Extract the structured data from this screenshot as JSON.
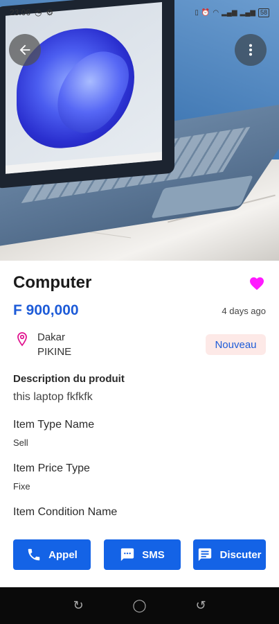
{
  "status_bar": {
    "time": "23:06",
    "left_icons": [
      "clock-icon",
      "notification-icon"
    ],
    "right_icons": [
      "vibrate-icon",
      "alarm-icon",
      "wifi-icon",
      "signal-icon",
      "signal-icon"
    ],
    "battery": "58"
  },
  "header": {
    "back_icon": "arrow-back-icon",
    "more_icon": "more-vertical-icon"
  },
  "product": {
    "title": "Computer",
    "price": "F 900,000",
    "posted": "4 days ago",
    "favorite_color": "#ff1aff",
    "location_city": "Dakar",
    "location_area": "PIKINE",
    "condition_badge": "Nouveau",
    "description_label": "Description du produit",
    "description": "this laptop fkfkfk"
  },
  "attributes": [
    {
      "label": "Item Type Name",
      "value": "Sell"
    },
    {
      "label": "Item Price Type",
      "value": "Fixe"
    },
    {
      "label": "Item Condition Name",
      "value": ""
    }
  ],
  "actions": {
    "call_label": "Appel",
    "sms_label": "SMS",
    "chat_label": "Discuter",
    "accent_color": "#1463e6"
  },
  "nav_bar": {
    "recent_icon": "recent-apps-icon",
    "home_icon": "home-icon",
    "back_icon": "back-icon"
  }
}
